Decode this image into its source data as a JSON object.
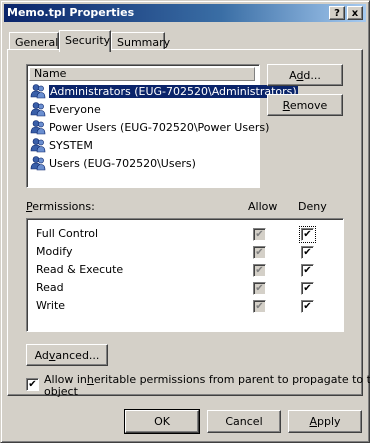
{
  "window": {
    "title": "Memo.tpl Properties",
    "help_label": "?",
    "close_label": "x"
  },
  "tabs": [
    {
      "label": "General"
    },
    {
      "label": "Security",
      "active": true
    },
    {
      "label": "Summary"
    }
  ],
  "users_list": {
    "column_header": "Name",
    "items": [
      {
        "label": "Administrators (EUG-702520\\Administrators)",
        "selected": true
      },
      {
        "label": "Everyone"
      },
      {
        "label": "Power Users (EUG-702520\\Power Users)"
      },
      {
        "label": "SYSTEM"
      },
      {
        "label": "Users (EUG-702520\\Users)"
      }
    ]
  },
  "buttons": {
    "add": {
      "pre": "A",
      "key": "d",
      "post": "d..."
    },
    "remove": {
      "pre": "",
      "key": "R",
      "post": "emove"
    },
    "advanced": {
      "pre": "Ad",
      "key": "v",
      "post": "anced..."
    },
    "ok": "OK",
    "cancel": "Cancel",
    "apply": {
      "pre": "",
      "key": "A",
      "post": "pply"
    }
  },
  "permissions": {
    "label": {
      "pre": "",
      "key": "P",
      "post": "ermissions:"
    },
    "allow_header": "Allow",
    "deny_header": "Deny",
    "check_glyph": "✔",
    "rows": [
      {
        "label": "Full Control",
        "allow": true,
        "allow_disabled": true,
        "deny": true
      },
      {
        "label": "Modify",
        "allow": true,
        "allow_disabled": true,
        "deny": true
      },
      {
        "label": "Read & Execute",
        "allow": true,
        "allow_disabled": true,
        "deny": true
      },
      {
        "label": "Read",
        "allow": true,
        "allow_disabled": true,
        "deny": true
      },
      {
        "label": "Write",
        "allow": true,
        "allow_disabled": true,
        "deny": true
      }
    ]
  },
  "inherit": {
    "checked": true,
    "line1_pre": "Allow in",
    "line1_key": "h",
    "line1_post": "eritable permissions from parent to propagate to this",
    "line2": "object"
  }
}
